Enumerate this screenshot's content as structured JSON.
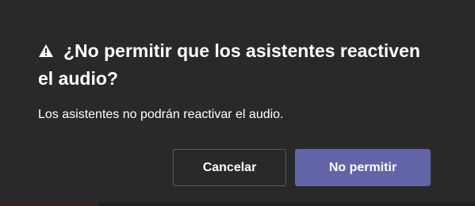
{
  "dialog": {
    "title": "¿No permitir que los asistentes reactiven el audio?",
    "title_icon": "warning-icon",
    "message": "Los asistentes no podrán reactivar el audio.",
    "cancel_label": "Cancelar",
    "confirm_label": "No permitir"
  },
  "colors": {
    "background": "#292929",
    "text": "#ffffff",
    "primary_button": "#6264a7",
    "secondary_button_border": "#5c5c5c"
  }
}
